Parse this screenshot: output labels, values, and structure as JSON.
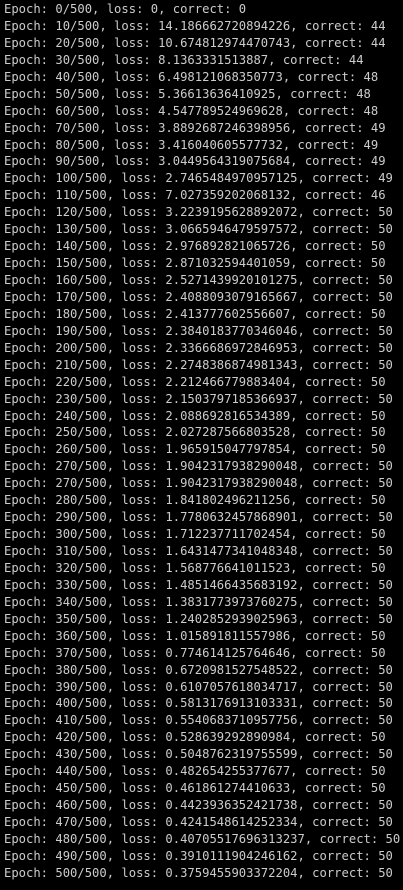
{
  "terminal": {
    "lines": [
      "Epoch: 0/500, loss: 0, correct: 0",
      "Epoch: 10/500, loss: 14.186662720894226, correct: 44",
      "Epoch: 20/500, loss: 10.674812974470743, correct: 44",
      "Epoch: 30/500, loss: 8.1363331513887, correct: 44",
      "Epoch: 40/500, loss: 6.498121068350773, correct: 48",
      "Epoch: 50/500, loss: 5.36613636410925, correct: 48",
      "Epoch: 60/500, loss: 4.547789524969628, correct: 48",
      "Epoch: 70/500, loss: 3.8892687246398956, correct: 49",
      "Epoch: 80/500, loss: 3.416040605577732, correct: 49",
      "Epoch: 90/500, loss: 3.0449564319075684, correct: 49",
      "Epoch: 100/500, loss: 2.7465484970957125, correct: 49",
      "Epoch: 110/500, loss: 7.027359202068132, correct: 46",
      "Epoch: 120/500, loss: 3.2239195628892072, correct: 50",
      "Epoch: 130/500, loss: 3.0665946479597572, correct: 50",
      "Epoch: 140/500, loss: 2.976892821065726, correct: 50",
      "Epoch: 150/500, loss: 2.871032594401059, correct: 50",
      "Epoch: 160/500, loss: 2.5271439920101275, correct: 50",
      "Epoch: 170/500, loss: 2.4088093079165667, correct: 50",
      "Epoch: 180/500, loss: 2.413777602556607, correct: 50",
      "Epoch: 190/500, loss: 2.3840183770346046, correct: 50",
      "Epoch: 200/500, loss: 2.3366686972846953, correct: 50",
      "Epoch: 210/500, loss: 2.2748386874981343, correct: 50",
      "Epoch: 220/500, loss: 2.212466779883404, correct: 50",
      "Epoch: 230/500, loss: 2.1503797185366937, correct: 50",
      "Epoch: 240/500, loss: 2.088692816534389, correct: 50",
      "Epoch: 250/500, loss: 2.027287566803528, correct: 50",
      "Epoch: 260/500, loss: 1.965915047797854, correct: 50",
      "Epoch: 270/500, loss: 1.9042317938290048, correct: 50",
      "Epoch: 270/500, loss: 1.9042317938290048, correct: 50",
      "Epoch: 280/500, loss: 1.841802496211256, correct: 50",
      "Epoch: 290/500, loss: 1.7780632457868901, correct: 50",
      "Epoch: 300/500, loss: 1.712237711702454, correct: 50",
      "Epoch: 310/500, loss: 1.6431477341048348, correct: 50",
      "Epoch: 320/500, loss: 1.568776641011523, correct: 50",
      "Epoch: 330/500, loss: 1.4851466435683192, correct: 50",
      "Epoch: 340/500, loss: 1.3831773973760275, correct: 50",
      "Epoch: 350/500, loss: 1.2402852939025963, correct: 50",
      "Epoch: 360/500, loss: 1.015891811557986, correct: 50",
      "Epoch: 370/500, loss: 0.774614125764646, correct: 50",
      "Epoch: 380/500, loss: 0.6720981527548522, correct: 50",
      "Epoch: 390/500, loss: 0.6107057618034717, correct: 50",
      "Epoch: 400/500, loss: 0.5813176913103331, correct: 50",
      "Epoch: 410/500, loss: 0.5540683710957756, correct: 50",
      "Epoch: 420/500, loss: 0.528639292890984, correct: 50",
      "Epoch: 430/500, loss: 0.5048762319755599, correct: 50",
      "Epoch: 440/500, loss: 0.482654255377677, correct: 50",
      "Epoch: 450/500, loss: 0.461861274410633, correct: 50",
      "Epoch: 460/500, loss: 0.4423936352421738, correct: 50",
      "Epoch: 470/500, loss: 0.4241548614252334, correct: 50",
      "Epoch: 480/500, loss: 0.40705517696313237, correct: 50",
      "Epoch: 490/500, loss: 0.3910111904246162, correct: 50",
      "Epoch: 500/500, loss: 0.3759455903372204, correct: 50"
    ]
  },
  "colors": {
    "background": "#000000",
    "text": "#cccccc"
  }
}
